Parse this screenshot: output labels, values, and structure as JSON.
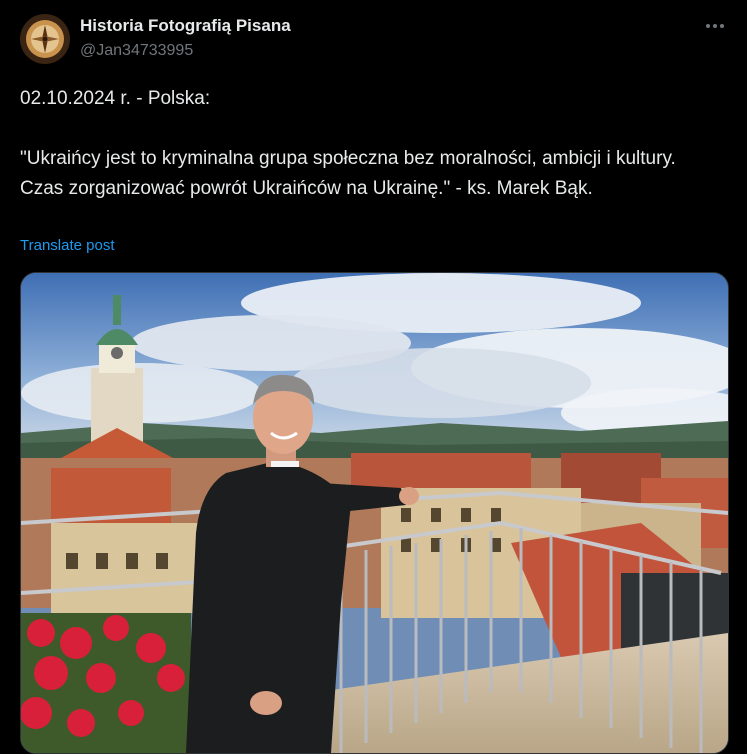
{
  "post": {
    "author_name": "Historia Fotografią Pisana",
    "author_handle": "@Jan34733995",
    "avatar_icon": "compass-icon",
    "text_line1": "02.10.2024 r. - Polska:",
    "text_quote": "\"Ukraińcy jest to kryminalna grupa społeczna bez moralności, ambicji i kultury. Czas zorganizować powrót Ukraińców na Ukrainę.\" - ks. Marek Bąk.",
    "translate_label": "Translate post",
    "more_icon": "more-options-icon"
  },
  "colors": {
    "background": "#000000",
    "text": "#e7e9ea",
    "secondary_text": "#71767b",
    "link": "#1d9bf0"
  }
}
